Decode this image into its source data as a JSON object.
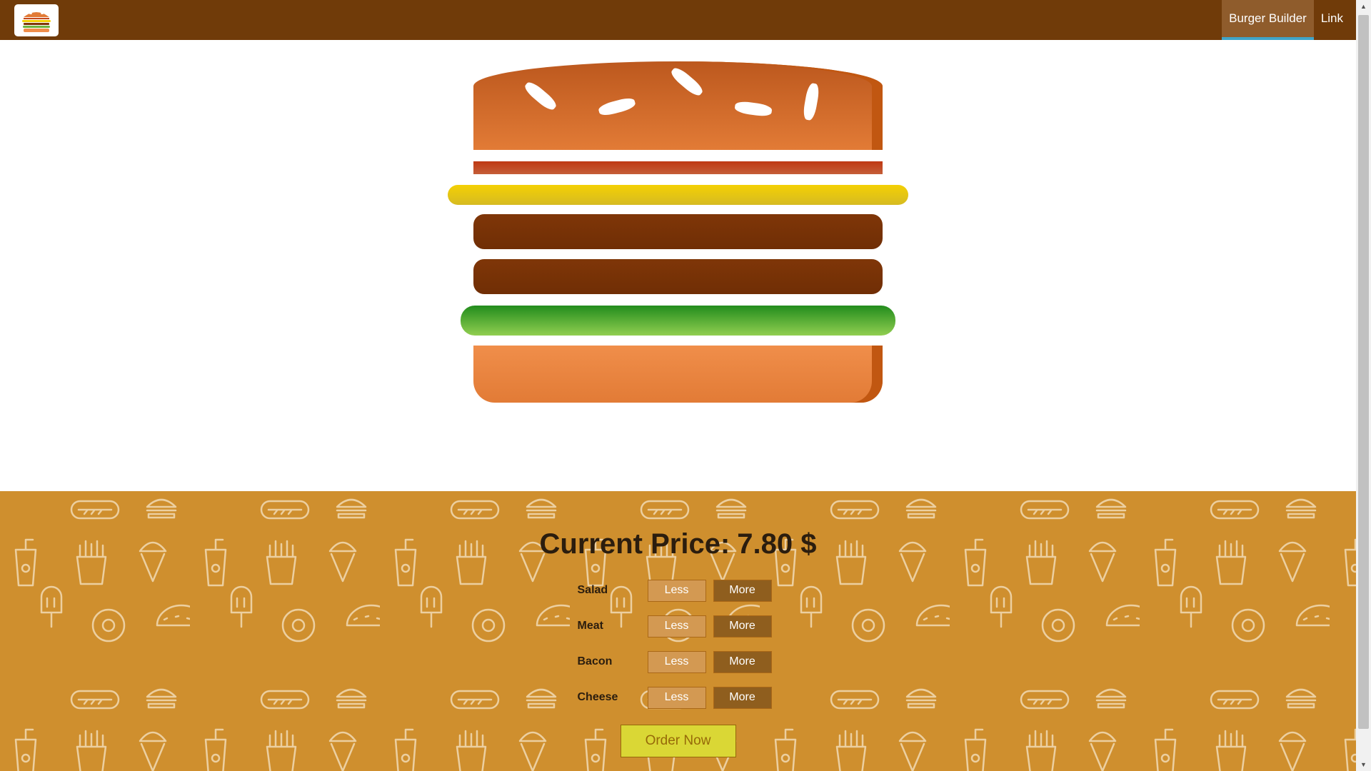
{
  "nav": {
    "items": [
      {
        "label": "Burger Builder",
        "active": true
      },
      {
        "label": "Link",
        "active": false
      }
    ]
  },
  "controls": {
    "price_label": "Current Price:",
    "price_value": "7.80 $",
    "ingredients": [
      {
        "label": "Salad",
        "less": "Less",
        "more": "More"
      },
      {
        "label": "Meat",
        "less": "Less",
        "more": "More"
      },
      {
        "label": "Bacon",
        "less": "Less",
        "more": "More"
      },
      {
        "label": "Cheese",
        "less": "Less",
        "more": "More"
      }
    ],
    "order_button": "Order Now"
  },
  "colors": {
    "toolbar": "#703b09",
    "controls_bg": "#cf8f2e",
    "nav_active_underline": "#40a4c8"
  }
}
